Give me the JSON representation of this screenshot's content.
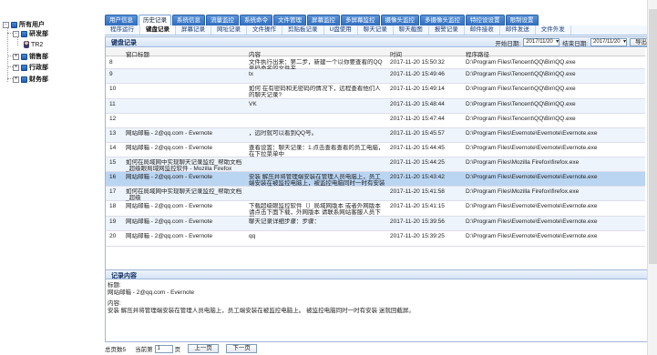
{
  "tree": {
    "root": "所有用户",
    "dept1": "研发部",
    "user1": "TR2",
    "dept2": "销售部",
    "dept3": "行政部",
    "dept4": "财务部"
  },
  "tabs_main": [
    "用户信息",
    "历史记录",
    "系统信息",
    "流量监控",
    "系统命令",
    "文件管理",
    "屏幕监控",
    "多屏幕监控",
    "摄像头监控",
    "多摄像头监控",
    "特控设设置",
    "限制设置"
  ],
  "tabs_sub": [
    "程序运行",
    "键盘记录",
    "屏幕记录",
    "网址记录",
    "文件操作",
    "剪贴板记录",
    "U盘使用",
    "聊天记录",
    "聊天截图",
    "报警记录",
    "邮件接收",
    "邮件发送",
    "文件外发"
  ],
  "panel": {
    "title": "键盘记录",
    "start_label": "开始日期:",
    "start_date": "2017/11/20",
    "end_label": "结束日期:",
    "end_date": "2017/11/20",
    "export_label": "导出"
  },
  "columns": {
    "title": "窗口标题",
    "content": "内容",
    "time": "时间",
    "path": "程序路径"
  },
  "rows": [
    {
      "num": "8",
      "title": "",
      "content": "文件执行出来：第二步，新建一个以你要查看的QQ号码命名的文件夹",
      "time": "2017-11-20 15:50:32",
      "path": "D:\\Program Files\\Tencent\\QQ\\Bin\\QQ.exe"
    },
    {
      "num": "9",
      "title": "",
      "content": "tx",
      "time": "2017-11-20 15:49:46",
      "path": "D:\\Program Files\\Tencent\\QQ\\Bin\\QQ.exe"
    },
    {
      "num": "10",
      "title": "",
      "content": "如何 在有密码和无密码的情况下，远程查看他们人的聊天记录?",
      "time": "2017-11-20 15:49:14",
      "path": "D:\\Program Files\\Tencent\\QQ\\Bin\\QQ.exe"
    },
    {
      "num": "11",
      "title": "",
      "content": "VK",
      "time": "2017-11-20 15:48:44",
      "path": "D:\\Program Files\\Tencent\\QQ\\Bin\\QQ.exe"
    },
    {
      "num": "12",
      "title": "",
      "content": "",
      "time": "2017-11-20 15:47:44",
      "path": "D:\\Program Files\\Tencent\\QQ\\Bin\\QQ.exe"
    },
    {
      "num": "13",
      "title": "网站邮箱 - 2@qq.com - Evernote",
      "content": "，远时就可以看到QQ号。",
      "time": "2017-11-20 15:45:57",
      "path": "D:\\Program Files\\Evernote\\Evernote\\Evernote.exe"
    },
    {
      "num": "14",
      "title": "网站邮箱 - 2@qq.com - Evernote",
      "content": "查看设置：聊天记录：1.点击查看查看的员工电脑，在下拉菜单中",
      "time": "2017-11-20 15:44:45",
      "path": "D:\\Program Files\\Evernote\\Evernote\\Evernote.exe"
    },
    {
      "num": "15",
      "title": "如何在局域网中实现聊天记录监控_帮助文档_超级眼局域网监控软件 - Mozilla Firefox",
      "content": "",
      "time": "2017-11-20 15:44:25",
      "path": "D:\\Program Files\\Mozilla Firefox\\firefox.exe"
    },
    {
      "num": "16",
      "title": "网站邮箱 - 2@qq.com - Evernote",
      "content": "安装 解压并将管理端安装在管理人员电脑上，员工端安装在被监控电脑上，被监控电脑同时一时有安装 迷就回截屏。",
      "time": "2017-11-20 15:43:42",
      "path": "D:\\Program Files\\Evernote\\Evernote\\Evernote.exe"
    },
    {
      "num": "17",
      "title": "如何在局域网中实现聊天记录监控_帮助文档_超级",
      "content": "",
      "time": "2017-11-20 15:41:58",
      "path": "D:\\Program Files\\Mozilla Firefox\\firefox.exe"
    },
    {
      "num": "18",
      "title": "网站邮箱 - 2@qq.com - Evernote",
      "content": "下载超级眼监控软件（）局域网版本 或者外网版本 请点击下面下载，外网版本 请联系网站客服人员下载",
      "time": "2017-11-20 15:41:15",
      "path": "D:\\Program Files\\Evernote\\Evernote\\Evernote.exe"
    },
    {
      "num": "19",
      "title": "网站邮箱 - 2@qq.com - Evernote",
      "content": "聊天记录详细步骤：步骤：",
      "time": "2017-11-20 15:39:56",
      "path": "D:\\Program Files\\Evernote\\Evernote\\Evernote.exe"
    },
    {
      "num": "20",
      "title": "网站邮箱 - 2@qq.com - Evernote",
      "content": "qq",
      "time": "2017-11-20 15:39:25",
      "path": "D:\\Program Files\\Evernote\\Evernote\\Evernote.exe"
    }
  ],
  "detail": {
    "section_title": "记录内容",
    "title_label": "标题:",
    "title_value": "网站邮箱 - 2@qq.com - Evernote",
    "content_label": "内容:",
    "content_value": "安装 解压并将管理端安装在管理人员电脑上，员工端安装在被监控电脑上。 被监控电脑同时一时有安装 迷就回截屏。"
  },
  "pager": {
    "total": "总页数5",
    "current_label": "当前第",
    "current": "1",
    "unit": "页",
    "prev": "上一页",
    "next": "下一页"
  }
}
